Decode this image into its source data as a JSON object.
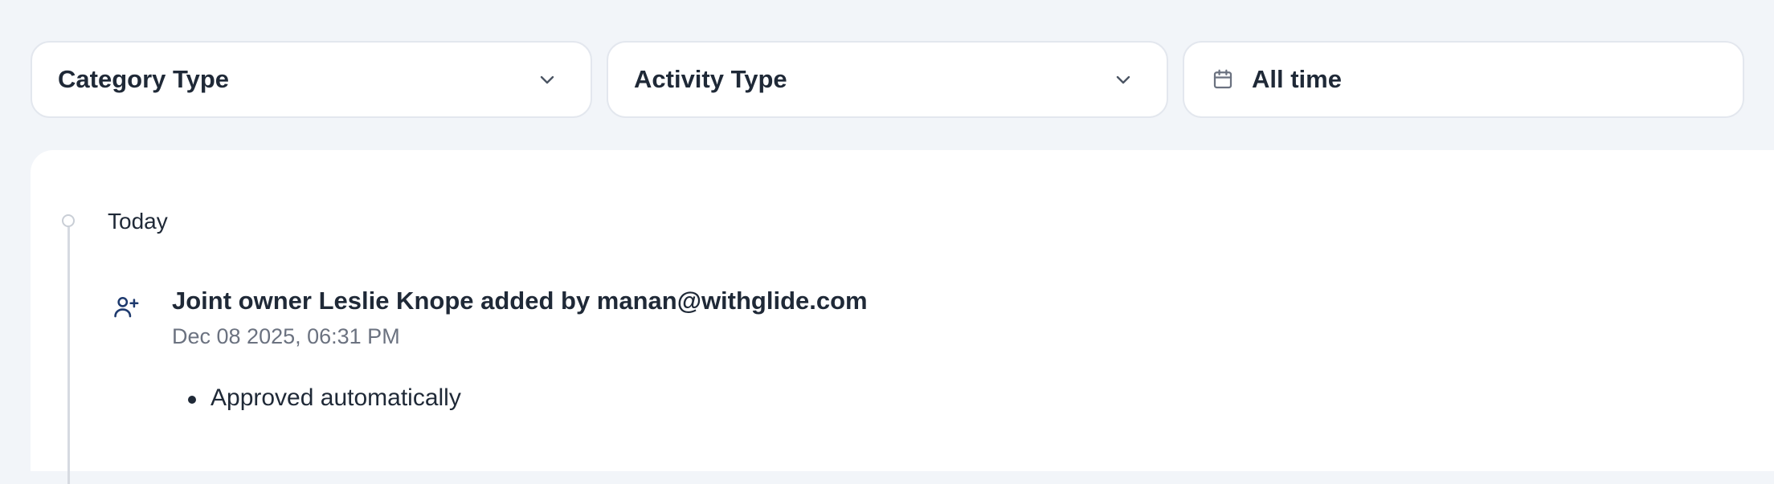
{
  "filters": {
    "category": {
      "label": "Category Type",
      "icon": "chevron-down-icon"
    },
    "activity": {
      "label": "Activity Type",
      "icon": "chevron-down-icon"
    },
    "date": {
      "label": "All time",
      "icon": "calendar-icon"
    }
  },
  "timeline": {
    "groups": [
      {
        "label": "Today",
        "events": [
          {
            "icon": "user-plus-icon",
            "title": "Joint owner Leslie Knope added by manan@withglide.com",
            "timestamp": "Dec 08 2025, 06:31 PM",
            "details": [
              "Approved automatically"
            ]
          }
        ]
      }
    ]
  },
  "colors": {
    "background": "#f2f5f9",
    "surface": "#ffffff",
    "text_primary": "#1f2937",
    "text_muted": "#6b7280",
    "icon_accent": "#1e3a6e",
    "border": "#e3e7ee"
  }
}
